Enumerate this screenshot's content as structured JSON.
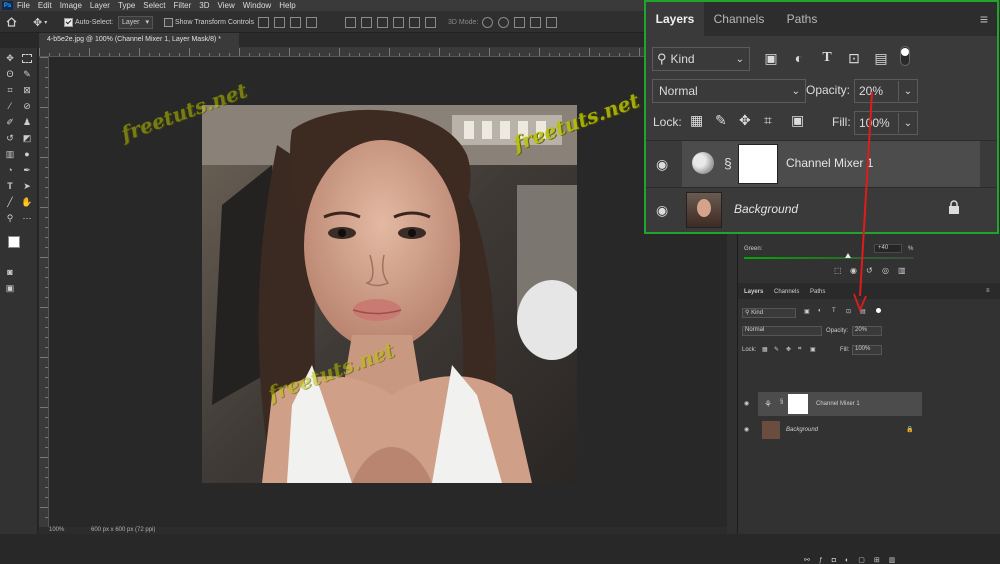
{
  "menu": {
    "logo": "Ps",
    "items": [
      "File",
      "Edit",
      "Image",
      "Layer",
      "Type",
      "Select",
      "Filter",
      "3D",
      "View",
      "Window",
      "Help"
    ]
  },
  "options": {
    "auto_select_label": "Auto-Select:",
    "auto_select_value": "Layer",
    "show_transform_label": "Show Transform Controls",
    "mode_3d_label": "3D Mode:"
  },
  "document": {
    "tab_title": "4-b5e2e.jpg @ 100% (Channel Mixer 1, Layer Mask/8) *",
    "zoom": "100%",
    "size_info": "600 px x 600 px (72 ppi)"
  },
  "properties_panel": {
    "green_label": "Green:",
    "green_value": "+40",
    "green_unit": "%"
  },
  "layers_panel": {
    "tabs": [
      "Layers",
      "Channels",
      "Paths"
    ],
    "kind_label": "Kind",
    "blend_mode": "Normal",
    "opacity_label": "Opacity:",
    "opacity_value": "20%",
    "lock_label": "Lock:",
    "fill_label": "Fill:",
    "fill_value": "100%",
    "layers": [
      {
        "name": "Channel Mixer 1",
        "selected": true,
        "visible": true
      },
      {
        "name": "Background",
        "selected": false,
        "visible": true,
        "locked": true
      }
    ]
  },
  "watermark_text": "freetuts.net",
  "colors": {
    "callout_border": "#1fa52c",
    "arrow": "#e01b1b",
    "selection": "#4c4c4c",
    "watermark": "#b9c400"
  }
}
